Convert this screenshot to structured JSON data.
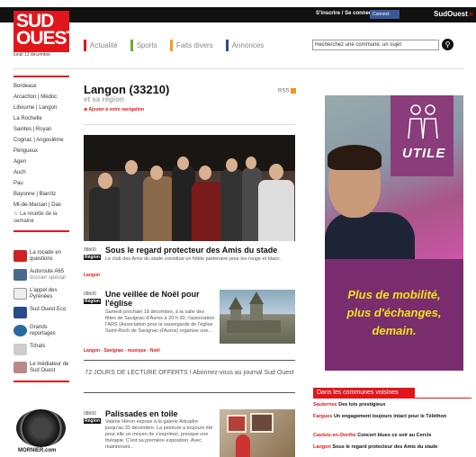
{
  "header": {
    "signin": "S'inscrire / Se connecter",
    "facebook": "Connect",
    "brand": "SudOuest",
    "brand_suffix": ".fr",
    "logo": "SUD OUEST",
    "date": "lundi 13 décembre"
  },
  "nav": {
    "items": [
      "Actualité",
      "Sports",
      "Faits divers",
      "Annonces"
    ],
    "search_placeholder": "Recherchez une commune, un sujet"
  },
  "sidebar": {
    "cities": [
      "Bordeaux",
      "Arcachon | Médoc",
      "Libourne | Langon",
      "La Rochelle",
      "Saintes | Royan",
      "Cognac | Angoulême",
      "Périgueux",
      "Agen",
      "Auch",
      "Pau",
      "Bayonne | Biarritz",
      "Mt-de-Marsan | Dax"
    ],
    "recette": "☆ La recette de la semaine",
    "links": [
      {
        "title": "La rocade en questions",
        "sub": ""
      },
      {
        "title": "Autoroute A65",
        "sub": "dossier spécial"
      },
      {
        "title": "L'appel des Pyrénées",
        "sub": ""
      },
      {
        "title": "Sud Ouest Eco",
        "sub": ""
      },
      {
        "title": "Grands reportages",
        "sub": ""
      },
      {
        "title": "Tchats",
        "sub": ""
      },
      {
        "title": "Le médiateur de Sud Ouest",
        "sub": ""
      }
    ],
    "ad_brand": "MORNIER.com"
  },
  "page": {
    "title": "Langon (33210)",
    "subtitle": "et sa région",
    "add_nav": "⊕ Ajouter à votre navigation",
    "rss": "RSS"
  },
  "articles": [
    {
      "time": "08h00",
      "tag": "Région",
      "title": "Sous le regard protecteur des Amis du stade",
      "desc": "Le club des Amis du stade constitue un fidèle partenaire pour les rouge et blanc.",
      "keywords": "Langon"
    },
    {
      "time": "08h00",
      "tag": "Région",
      "title": "Une veillée de Noël pour l'église",
      "desc": "Samedi prochain 18 décembre, à la salle des fêtes de Savignac-d'Auros à 20 h 30, l'association l'ARS (Association pour la sauvegarde de l'église Saint-Roch de Savignac-d'Auros) organise une...",
      "keywords": "Langon - Savignac - musique - Noël"
    },
    {
      "time": "08h00",
      "tag": "Région",
      "title": "Palissades en toile",
      "desc": "Valérie Héron expose à la galerie Artcadre jusqu'au 31 décembre. La peinture a toujours été pour elle un moyen de s'exprimer, presque une thérapie. C'est sa première exposition. Avec maintenant...",
      "keywords": ""
    }
  ],
  "promo": "72 JOURS DE LECTURE OFFERTS ! Abonnez-vous au journal Sud Ouest",
  "ad": {
    "badge": "UTILE",
    "slogan": [
      "Plus de mobilité,",
      "plus d'échanges,",
      "demain."
    ]
  },
  "communes": {
    "header": "Dans les communes voisines",
    "items": [
      {
        "town": "Sauternes",
        "text": "Des lots prestigieux"
      },
      {
        "town": "Fargues",
        "text": "Un engagement toujours intact pour le Téléthon"
      },
      {
        "town": "Castets-en-Dorthe",
        "text": "Concert blues ce soir au Cercle"
      },
      {
        "town": "Langon",
        "text": "Sous le regard protecteur des Amis du stade"
      }
    ]
  },
  "colors": {
    "brand_red": "#e0161b",
    "sports_green": "#6ab023",
    "faits_orange": "#f0a020",
    "annonces_blue": "#2c4a9a",
    "ad_purple": "#7a2d6e",
    "ad_yellow": "#f3e21a"
  }
}
